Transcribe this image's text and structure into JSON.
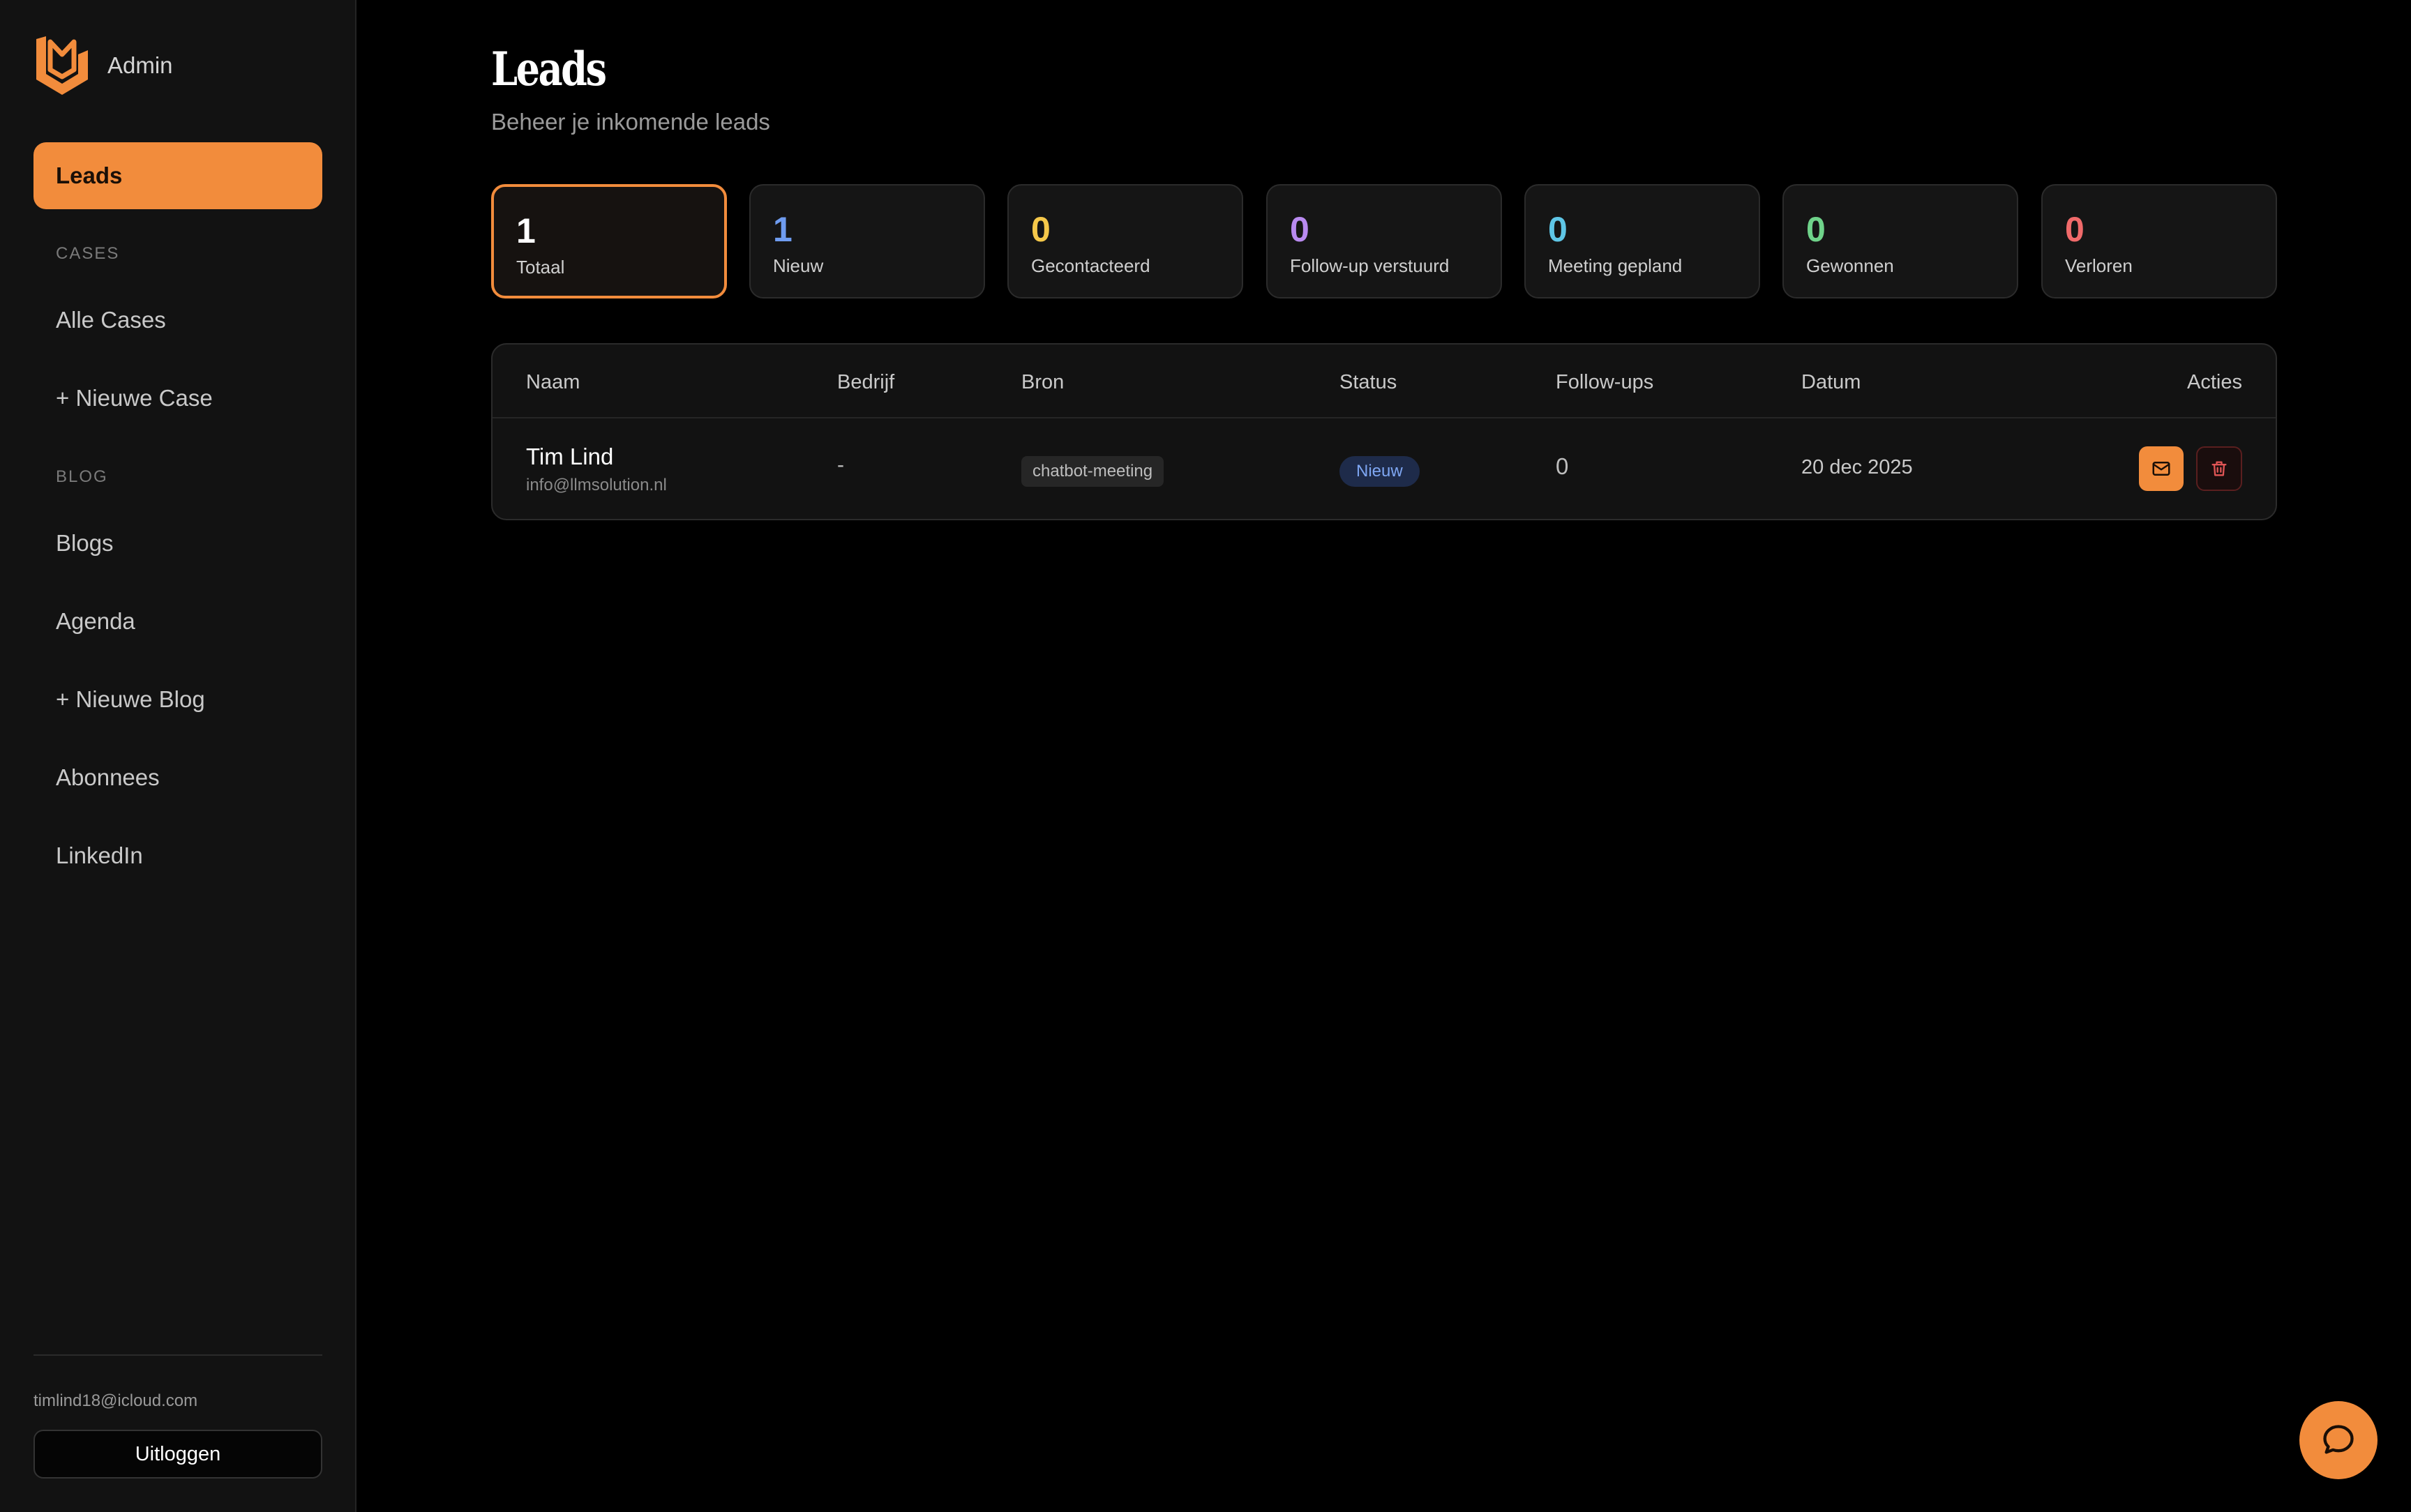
{
  "sidebar": {
    "brand": "Admin",
    "active_item": "Leads",
    "cases_section": "CASES",
    "cases_items": [
      "Alle Cases",
      "+ Nieuwe Case"
    ],
    "blog_section": "BLOG",
    "blog_items": [
      "Blogs",
      "Agenda",
      "+ Nieuwe Blog",
      "Abonnees",
      "LinkedIn"
    ],
    "user_email": "timlind18@icloud.com",
    "logout_label": "Uitloggen"
  },
  "header": {
    "title": "Leads",
    "subtitle": "Beheer je inkomende leads"
  },
  "stats": [
    {
      "value": "1",
      "label": "Totaal",
      "color": "#ffffff"
    },
    {
      "value": "1",
      "label": "Nieuw",
      "color": "#6f9cf0"
    },
    {
      "value": "0",
      "label": "Gecontacteerd",
      "color": "#f5c84a"
    },
    {
      "value": "0",
      "label": "Follow-up verstuurd",
      "color": "#b98af0"
    },
    {
      "value": "0",
      "label": "Meeting gepland",
      "color": "#5fc6e6"
    },
    {
      "value": "0",
      "label": "Gewonnen",
      "color": "#6fd38a"
    },
    {
      "value": "0",
      "label": "Verloren",
      "color": "#f06a6a"
    }
  ],
  "table": {
    "columns": [
      "Naam",
      "Bedrijf",
      "Bron",
      "Status",
      "Follow-ups",
      "Datum",
      "Acties"
    ],
    "rows": [
      {
        "name": "Tim Lind",
        "email": "info@llmsolution.nl",
        "company": "-",
        "source": "chatbot-meeting",
        "status": "Nieuw",
        "followups": "0",
        "date": "20 dec 2025"
      }
    ]
  },
  "icons": {
    "logo": "shield-logo-icon",
    "mail": "mail-icon",
    "delete": "trash-icon",
    "chat": "chat-bubble-icon"
  },
  "colors": {
    "accent": "#f28c3c",
    "background": "#000000",
    "sidebar": "#121212"
  }
}
